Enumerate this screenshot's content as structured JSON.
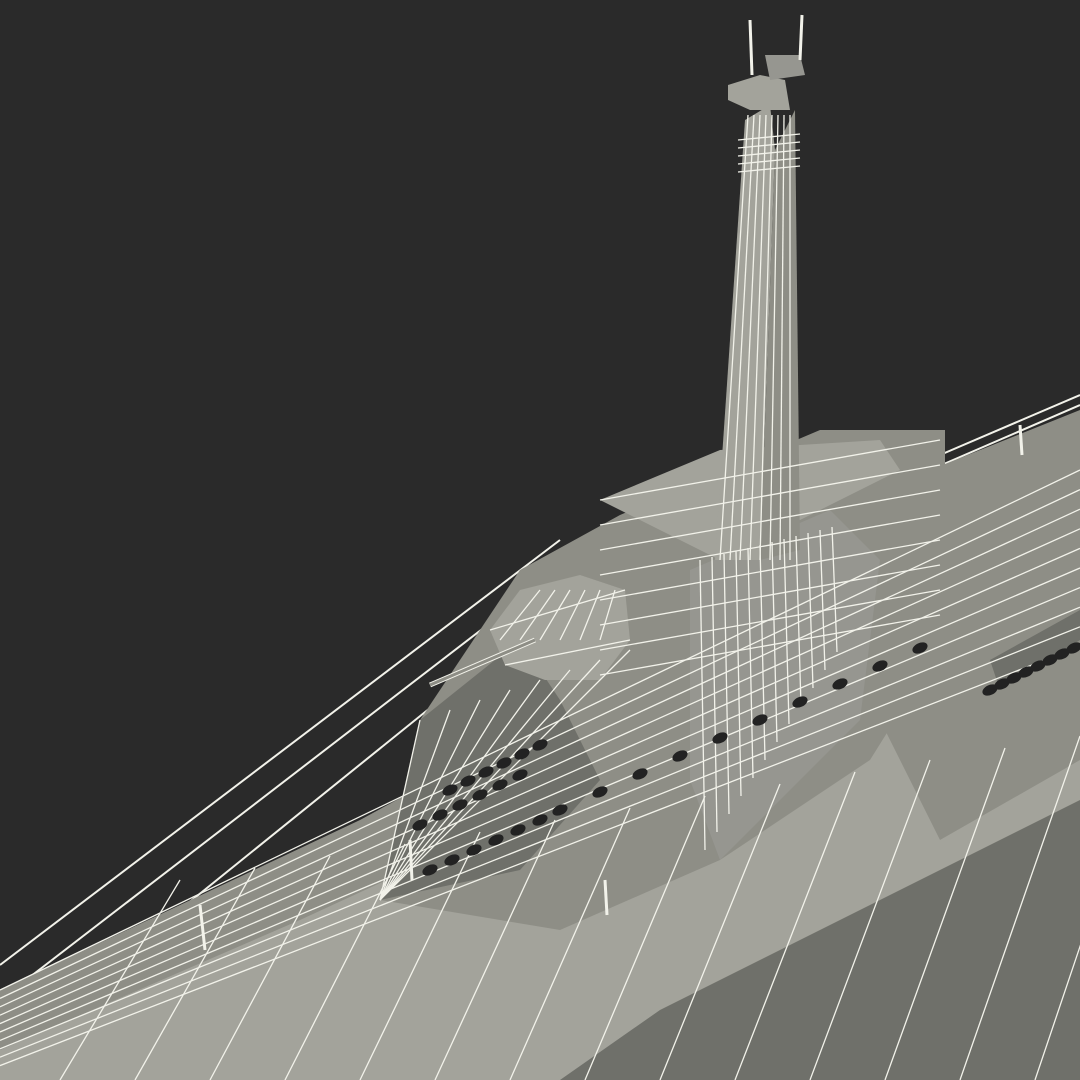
{
  "scene": {
    "subject": "submarine-conning-tower-wireframe",
    "colors": {
      "background": "#2a2a2a",
      "hull": "#8e8e86",
      "hull_shadow": "#6f706a",
      "hull_light": "#a3a39b",
      "wire": "#f2f2ea",
      "port": "#222222"
    }
  }
}
